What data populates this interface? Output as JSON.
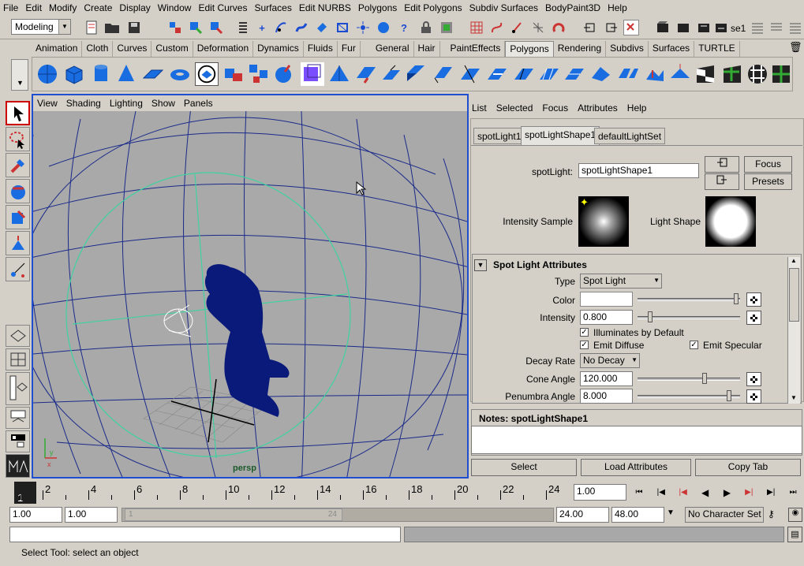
{
  "menubar": [
    "File",
    "Edit",
    "Modify",
    "Create",
    "Display",
    "Window",
    "Edit Curves",
    "Surfaces",
    "Edit NURBS",
    "Polygons",
    "Edit Polygons",
    "Subdiv Surfaces",
    "BodyPaint3D",
    "Help"
  ],
  "status": {
    "mode": "Modeling",
    "sel_label": "se1"
  },
  "shelf_tabs": [
    "Animation",
    "Cloth",
    "Curves",
    "Custom",
    "Deformation",
    "Dynamics",
    "Fluids",
    "Fur",
    "General",
    "Hair",
    "PaintEffects",
    "Polygons",
    "Rendering",
    "Subdivs",
    "Surfaces",
    "TURTLE"
  ],
  "shelf_active": "Polygons",
  "viewport": {
    "menu": [
      "View",
      "Shading",
      "Lighting",
      "Show",
      "Panels"
    ],
    "camera": "persp"
  },
  "ae": {
    "menu": [
      "List",
      "Selected",
      "Focus",
      "Attributes",
      "Help"
    ],
    "tabs": [
      "spotLight1",
      "spotLightShape1",
      "defaultLightSet"
    ],
    "node_label": "spotLight:",
    "node_value": "spotLightShape1",
    "focus": "Focus",
    "presets": "Presets",
    "intensity_sample": "Intensity Sample",
    "light_shape": "Light Shape",
    "section": "Spot Light Attributes",
    "type_label": "Type",
    "type_value": "Spot Light",
    "color_label": "Color",
    "intensity_label": "Intensity",
    "intensity_value": "0.800",
    "illum": "Illuminates by Default",
    "emit_diffuse": "Emit Diffuse",
    "emit_specular": "Emit Specular",
    "decay_label": "Decay Rate",
    "decay_value": "No Decay",
    "cone_label": "Cone Angle",
    "cone_value": "120.000",
    "penumbra_label": "Penumbra Angle",
    "penumbra_value": "8.000",
    "notes": "Notes: spotLightShape1",
    "select": "Select",
    "load": "Load Attributes",
    "copy": "Copy Tab"
  },
  "timeline": {
    "ticks": [
      "2",
      "4",
      "6",
      "8",
      "10",
      "12",
      "14",
      "16",
      "18",
      "20",
      "22",
      "24"
    ],
    "current": "1",
    "current_field": "1.00"
  },
  "range": {
    "start": "1.00",
    "inner_start": "1.00",
    "handle_start": "1",
    "handle_end": "24",
    "end": "24.00",
    "outer_end": "48.00",
    "charset": "No Character Set"
  },
  "help_line": "Select Tool: select an object"
}
